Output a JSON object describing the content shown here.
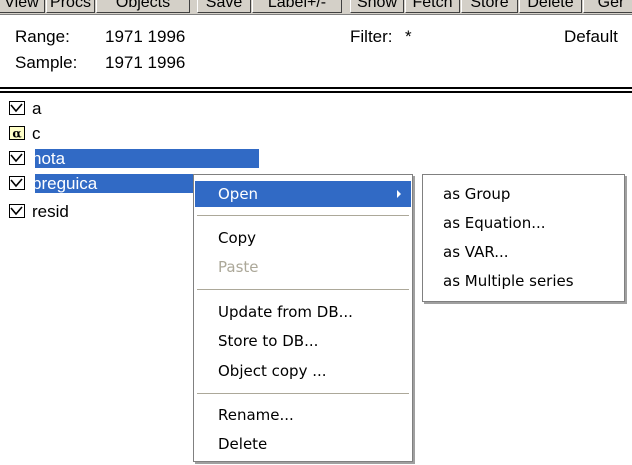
{
  "toolbar": {
    "buttons": [
      "View",
      "Procs",
      "Objects",
      "Save",
      "Label+/-",
      "Show",
      "Fetch",
      "Store",
      "Delete",
      "Ger"
    ]
  },
  "info": {
    "range_label": "Range:",
    "range_value": "1971 1996",
    "sample_label": "Sample:",
    "sample_value": "1971 1996",
    "filter_label": "Filter:",
    "filter_value": "*",
    "default_text": "Default"
  },
  "objects": [
    {
      "name": "a",
      "icon": "series-icon",
      "selected": false
    },
    {
      "name": "c",
      "icon": "coefficient-alpha-icon",
      "selected": false
    },
    {
      "name": "nota",
      "icon": "series-icon",
      "selected": true
    },
    {
      "name": "preguica",
      "icon": "series-icon",
      "selected": true
    },
    {
      "name": "resid",
      "icon": "series-icon",
      "selected": false
    }
  ],
  "context_menu": {
    "open": "Open",
    "copy": "Copy",
    "paste": "Paste",
    "update_from_db": "Update from DB...",
    "store_to_db": "Store to DB...",
    "object_copy": "Object copy ...",
    "rename": "Rename...",
    "delete": "Delete"
  },
  "open_submenu": {
    "as_group": "as Group",
    "as_equation": "as Equation...",
    "as_var": "as VAR...",
    "as_multiple_series": "as Multiple series"
  },
  "colors": {
    "selection": "#316ac5",
    "toolbar_face": "#d4d0c8",
    "disabled_text": "#aca899"
  }
}
